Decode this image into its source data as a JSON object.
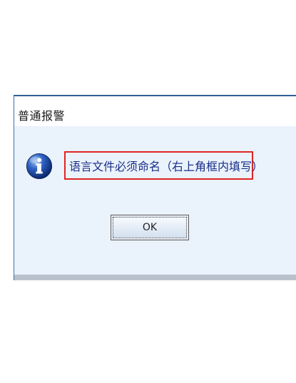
{
  "dialog": {
    "title": "普通报警",
    "message": "语言文件必须命名（右上角框内填写）",
    "ok_label": "OK",
    "icon": "info-icon"
  },
  "colors": {
    "highlight_border": "#e02424",
    "message_text": "#1a2f8a",
    "content_background": "#eaf2fb",
    "title_border": "#2e5f94"
  }
}
